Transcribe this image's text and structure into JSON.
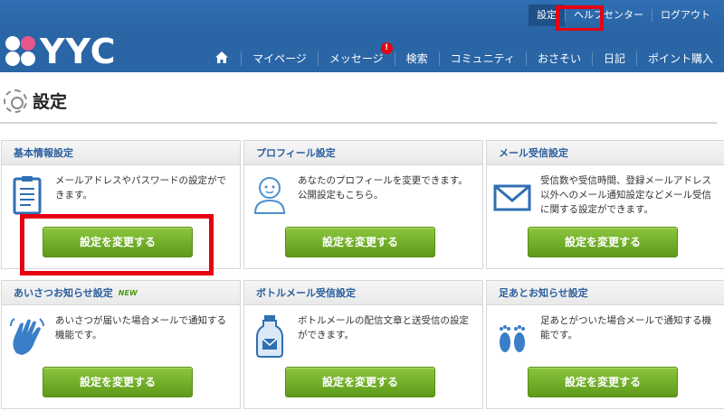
{
  "top_links": [
    {
      "label": "設定",
      "active": true
    },
    {
      "label": "ヘルプセンター",
      "active": false
    },
    {
      "label": "ログアウト",
      "active": false
    }
  ],
  "logo": {
    "text": "YYC"
  },
  "nav": {
    "home_icon": "home-icon",
    "items": [
      {
        "label": "マイページ"
      },
      {
        "label": "メッセージ",
        "badge": "!"
      },
      {
        "label": "検索"
      },
      {
        "label": "コミュニティ"
      },
      {
        "label": "おさそい"
      },
      {
        "label": "日記"
      },
      {
        "label": "ポイント購入"
      }
    ]
  },
  "page": {
    "title": "設定",
    "icon": "gear-icon"
  },
  "cards": [
    {
      "title": "基本情報設定",
      "desc": "メールアドレスやパスワードの設定ができます。",
      "button": "設定を変更する",
      "icon": "document-icon"
    },
    {
      "title": "プロフィール設定",
      "desc": "あなたのプロフィールを変更できます。公開設定もこちら。",
      "button": "設定を変更する",
      "icon": "person-icon"
    },
    {
      "title": "メール受信設定",
      "desc": "受信数や受信時間、登録メールアドレス以外へのメール通知設定などメール受信に関する設定ができます。",
      "button": "設定を変更する",
      "icon": "envelope-icon"
    },
    {
      "title": "あいさつお知らせ設定",
      "badge": "NEW",
      "desc": "あいさつが届いた場合メールで通知する機能です。",
      "button": "設定を変更する",
      "icon": "waving-hand-icon"
    },
    {
      "title": "ボトルメール受信設定",
      "desc": "ボトルメールの配信文章と送受信の設定ができます。",
      "button": "設定を変更する",
      "icon": "bottle-icon"
    },
    {
      "title": "足あとお知らせ設定",
      "desc": "足あとがついた場合メールで通知する機能です。",
      "button": "設定を変更する",
      "icon": "footprints-icon"
    }
  ],
  "colors": {
    "header": "#2a65a6",
    "accent_green": "#6aa823",
    "highlight_red": "#e60012",
    "title_blue": "#2a5f9e"
  }
}
